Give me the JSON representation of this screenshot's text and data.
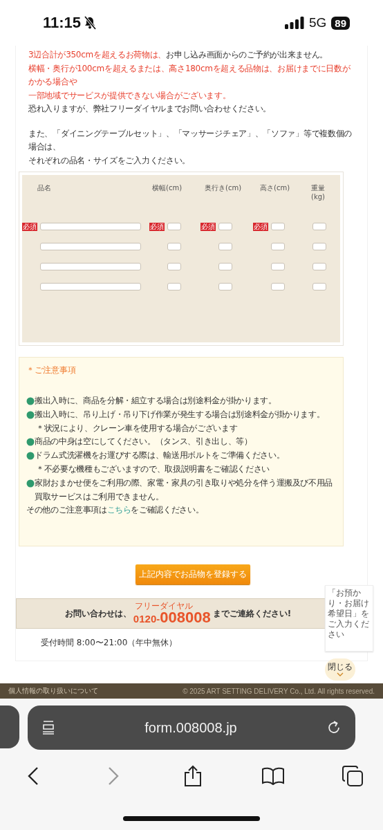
{
  "status_bar": {
    "time": "11:15",
    "network": "5G",
    "battery": "89",
    "silent": true
  },
  "intro_lines": [
    {
      "segments": [
        {
          "text": "3辺合計が350cmを超えるお荷物は、",
          "red": true
        },
        {
          "text": "お申し込み画面からのご予約が出来ません。",
          "red": false
        }
      ]
    },
    {
      "segments": [
        {
          "text": "横幅・奥行が100cmを超えるまたは、高さ180cmを超える品物は、お届けまでに日数がかかる場合や",
          "red": true
        }
      ]
    },
    {
      "segments": [
        {
          "text": "一部地域でサービスが提供できない場合がございます。",
          "red": true
        }
      ]
    },
    {
      "segments": [
        {
          "text": "恐れ入りますが、弊社フリーダイヤルまでお問い合わせください。",
          "red": false
        }
      ]
    }
  ],
  "multi_note": [
    "また、「ダイニングテーブルセット」、「マッサージチェア」、「ソファ」等で複数個の場合は、",
    "それぞれの品名・サイズをご入力ください。"
  ],
  "item_table": {
    "columns": [
      "品名",
      "横幅(cm)",
      "奥行き(cm)",
      "高さ(cm)",
      "重量(kg)"
    ],
    "rows": [
      {
        "cells": [
          {
            "required": true,
            "badge": "必須"
          },
          {
            "required": true,
            "badge": "必須"
          },
          {
            "required": true,
            "badge": "必須"
          },
          {
            "required": true,
            "badge": "必須"
          },
          {
            "required": false
          }
        ]
      },
      {
        "cells": [
          {
            "required": false
          },
          {
            "required": false
          },
          {
            "required": false
          },
          {
            "required": false
          },
          {
            "required": false
          }
        ]
      },
      {
        "cells": [
          {
            "required": false
          },
          {
            "required": false
          },
          {
            "required": false
          },
          {
            "required": false
          },
          {
            "required": false
          }
        ]
      },
      {
        "cells": [
          {
            "required": false
          },
          {
            "required": false
          },
          {
            "required": false
          },
          {
            "required": false
          },
          {
            "required": false
          }
        ]
      }
    ]
  },
  "notice": {
    "title": "＊ご注意事項",
    "items": [
      {
        "kind": "bullet",
        "segments": [
          {
            "text": "搬出入時に、商品を分解・組立する場合は別途料金が掛かります。"
          }
        ]
      },
      {
        "kind": "bullet",
        "segments": [
          {
            "text": "搬出入時に、吊り上げ・吊り下げ作業が発生する場合は別途料金が掛かります。"
          }
        ]
      },
      {
        "kind": "sub",
        "segments": [
          {
            "text": "＊状況により、クレーン車を使用する場合がございます"
          }
        ]
      },
      {
        "kind": "bullet",
        "segments": [
          {
            "text": "商品の中身は空にしてください。（タンス、引き出し、等）"
          }
        ]
      },
      {
        "kind": "bullet",
        "segments": [
          {
            "text": "ドラム式洗濯機をお運びする際は、輸送用ボルトをご準備ください。"
          }
        ]
      },
      {
        "kind": "sub",
        "segments": [
          {
            "text": "＊不必要な機種もございますので、取扱説明書をご確認ください"
          }
        ]
      },
      {
        "kind": "bullet",
        "segments": [
          {
            "text": "家財おまかせ便をご利用の際、家電・家具の引き取りや処分を伴う運搬及び不用品買取サービスはご利用できません。"
          }
        ]
      },
      {
        "kind": "plain",
        "segments": [
          {
            "text": "その他のご注意事項は"
          },
          {
            "text": "こちら",
            "link": true
          },
          {
            "text": "をご確認ください。"
          }
        ]
      }
    ]
  },
  "submit_button": "上記内容でお品物を登録する",
  "contact_banner": {
    "lead": "お問い合わせは、",
    "caption": "フリーダイヤル",
    "number_prefix": "0120-",
    "number": "008008",
    "tail": "までご連絡ください!"
  },
  "hours": "受付時間 8:00〜21:00（年中無休）",
  "side_note": "「お預かり・お届け希望日」をご入力ください",
  "close_button": "閉じる",
  "footer": {
    "privacy_link": "個人情報の取り扱いについて",
    "copyright": "© 2025 ART SETTING DELIVERY Co., Ltd. All rights reserved."
  },
  "browser": {
    "url": "form.008008.jp"
  }
}
